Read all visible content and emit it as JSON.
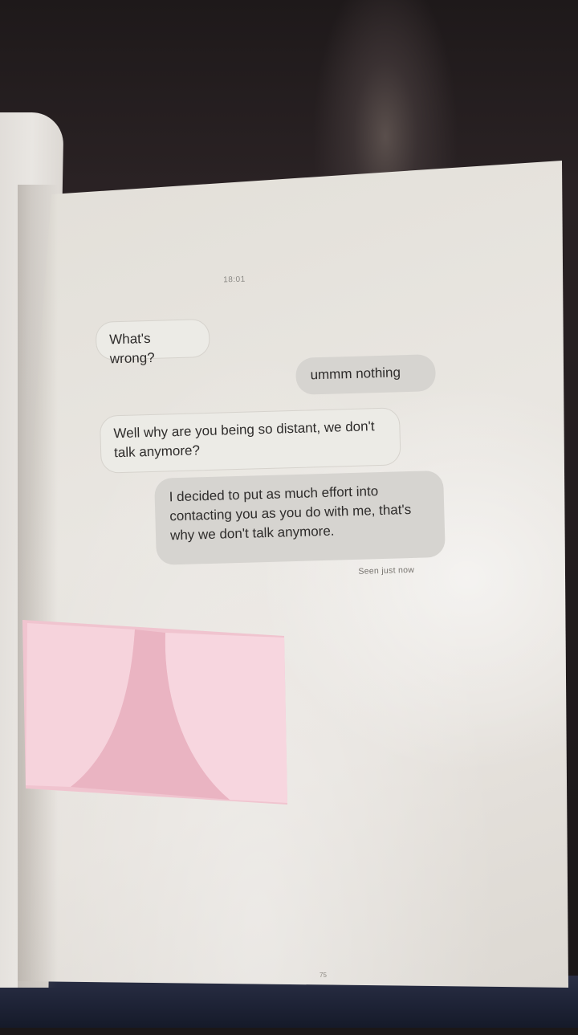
{
  "chat": {
    "timestamp": "18:01",
    "messages": [
      {
        "from": "other",
        "text": "What's wrong?"
      },
      {
        "from": "me",
        "text": "ummm nothing"
      },
      {
        "from": "other",
        "text": "Well why are you being so distant, we don't talk anymore?"
      },
      {
        "from": "me",
        "text": "I decided to put as much effort into contacting you as you do with me, that's why we don't talk anymore."
      }
    ],
    "status": "Seen just now"
  },
  "page": {
    "number": "75"
  },
  "colors": {
    "paper": "#e7e4df",
    "received_bubble": "#ecebe6",
    "sent_bubble": "#d6d4d0",
    "sticky_note": "#f2c6d2"
  }
}
